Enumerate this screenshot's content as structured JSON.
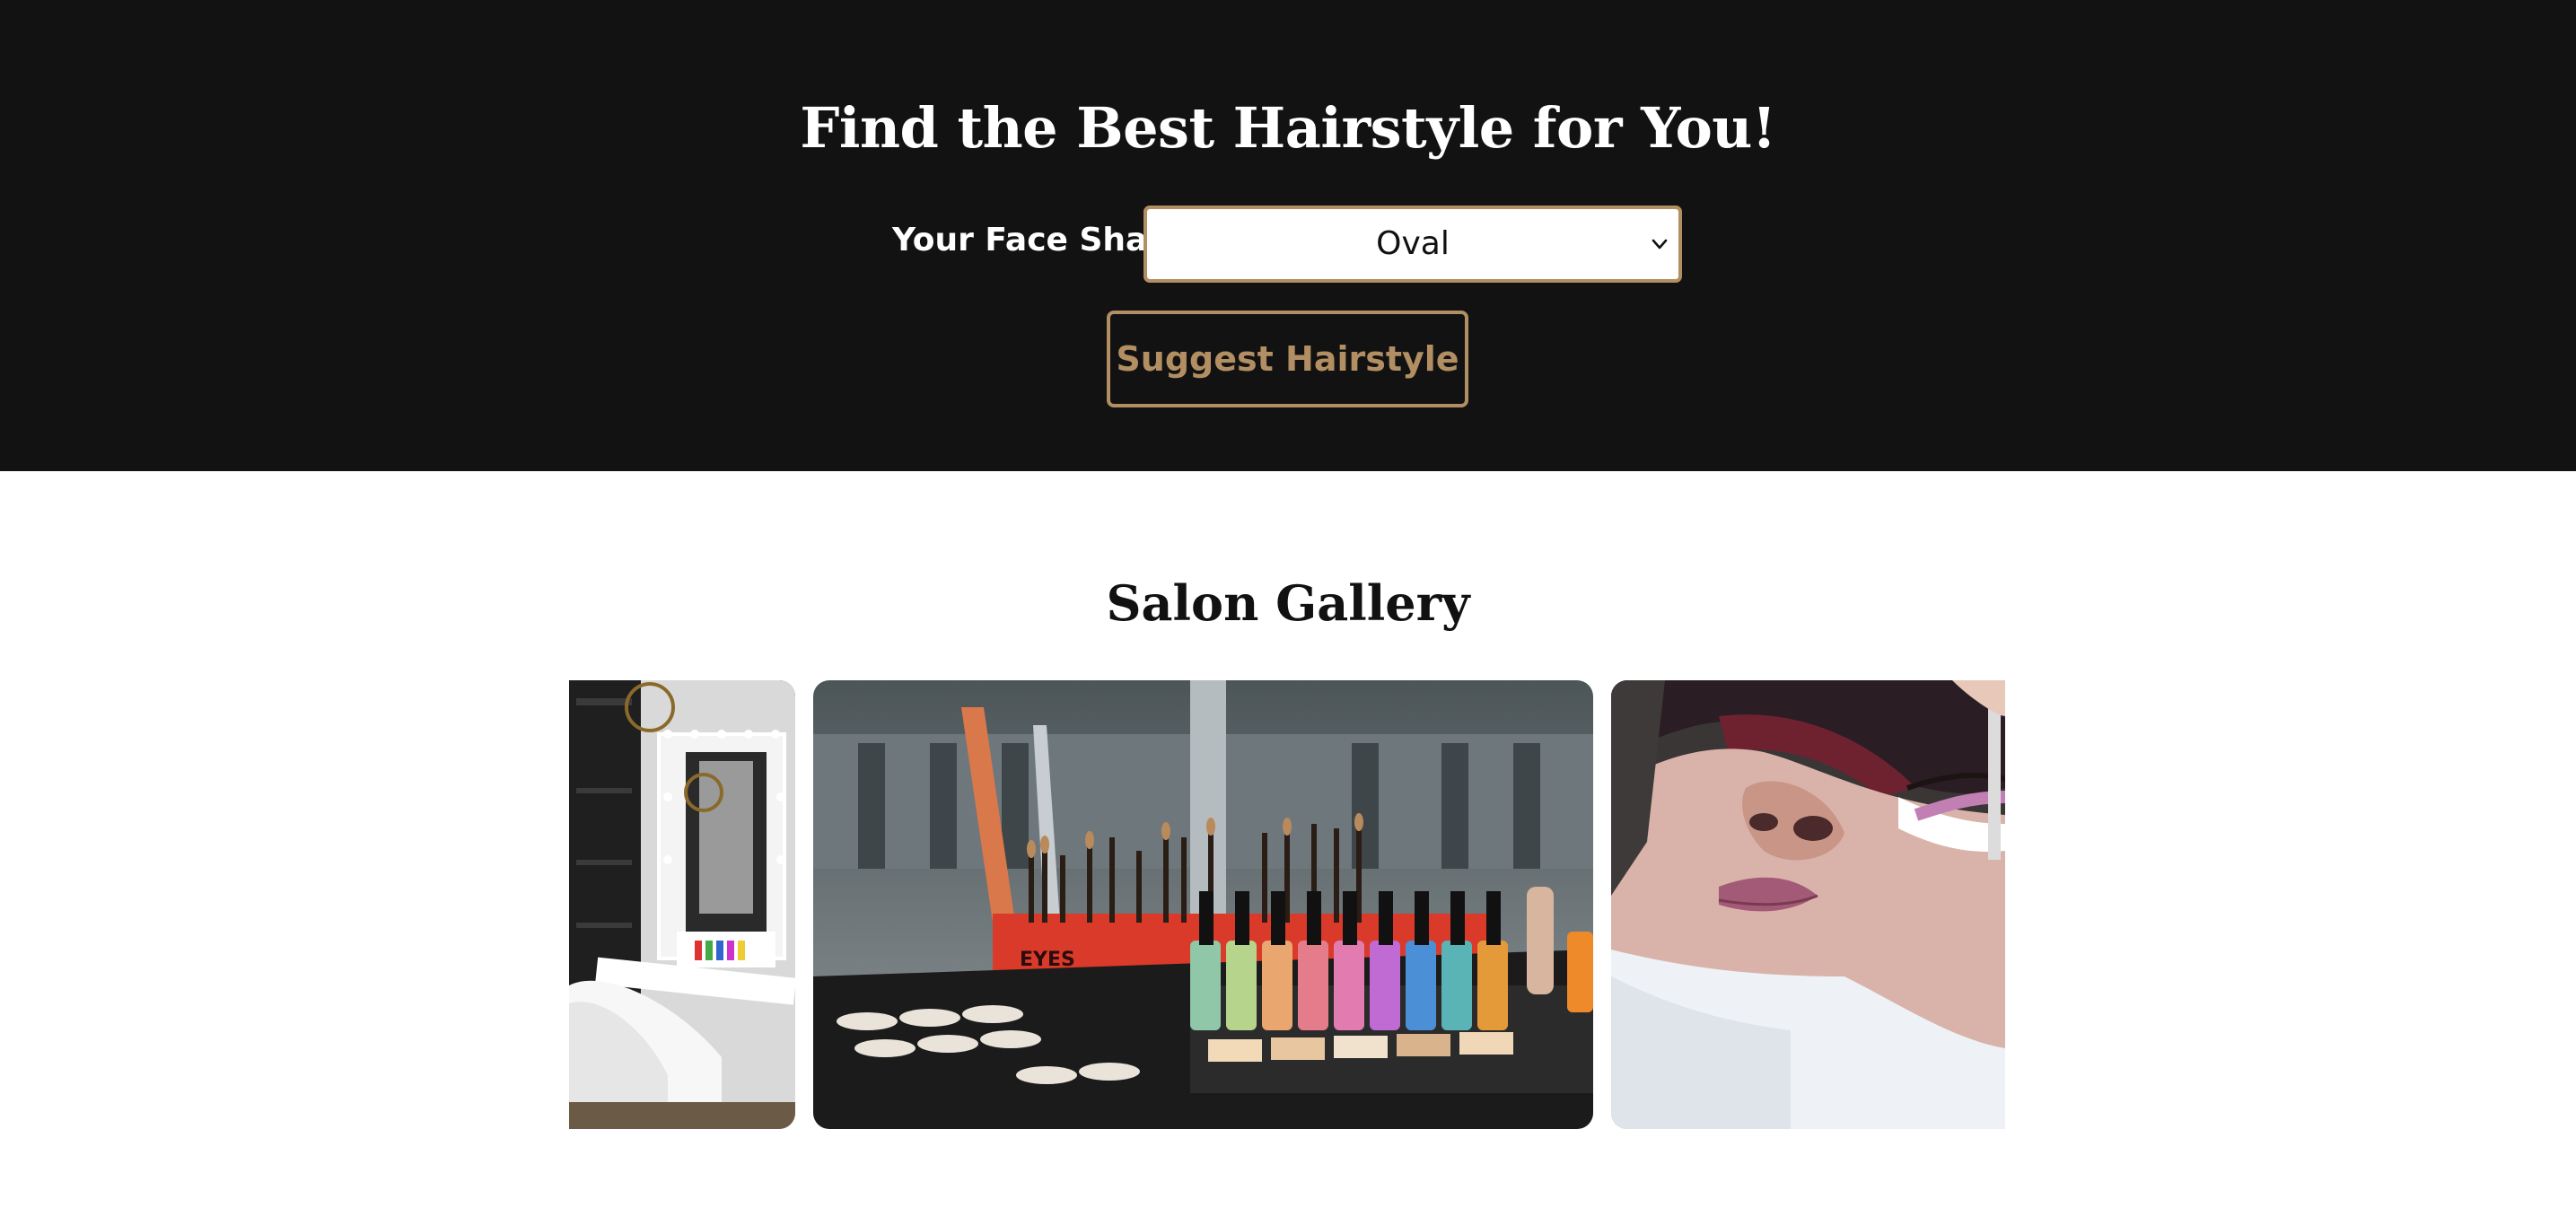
{
  "hero": {
    "title": "Find the Best Hairstyle for You!",
    "face_shape_label": "Your Face Shape",
    "face_shape_selected": "Oval",
    "suggest_button_label": "Suggest Hairstyle"
  },
  "gallery": {
    "title": "Salon Gallery",
    "images": [
      {
        "name": "salon-interior-photo",
        "eyes_sign": ""
      },
      {
        "name": "makeup-counter-photo",
        "eyes_sign": "EYES"
      },
      {
        "name": "lash-treatment-photo",
        "eyes_sign": ""
      }
    ]
  },
  "colors": {
    "hero_bg": "#121212",
    "accent": "#b28e63",
    "text_dark": "#111111"
  },
  "icons": {
    "select_chevron": "chevron-down-icon"
  }
}
